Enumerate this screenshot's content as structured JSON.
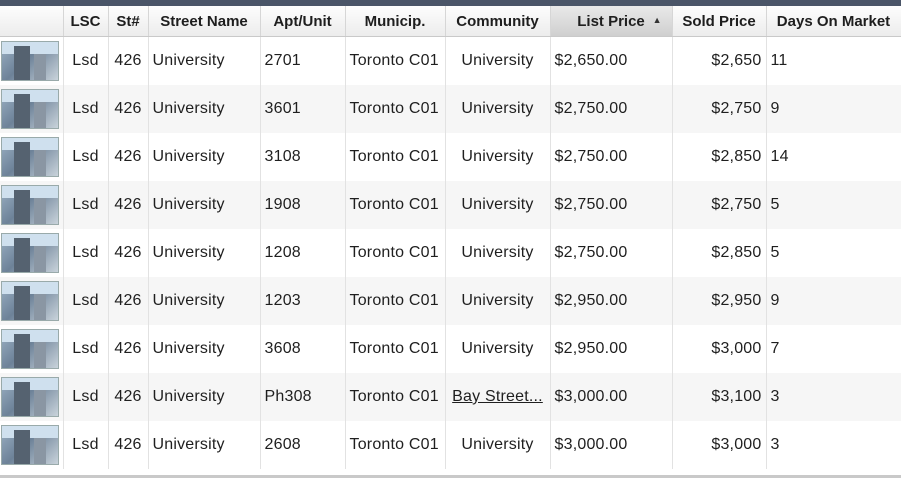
{
  "columns": {
    "lsc": "LSC",
    "st_num": "St#",
    "street_name": "Street Name",
    "apt_unit": "Apt/Unit",
    "municip": "Municip.",
    "community": "Community",
    "list_price": "List Price",
    "sold_price": "Sold Price",
    "days_on_market": "Days On Market"
  },
  "sort": {
    "column": "list_price",
    "direction": "ascending",
    "icon": "sort-up-arrow-icon"
  },
  "rows": [
    {
      "lsc": "Lsd",
      "st_num": "426",
      "street_name": "University",
      "apt_unit": "2701",
      "municip": "Toronto C01",
      "community": "University",
      "list_price": "$2,650.00",
      "sold_price": "$2,650",
      "dom": "11"
    },
    {
      "lsc": "Lsd",
      "st_num": "426",
      "street_name": "University",
      "apt_unit": "3601",
      "municip": "Toronto C01",
      "community": "University",
      "list_price": "$2,750.00",
      "sold_price": "$2,750",
      "dom": "9"
    },
    {
      "lsc": "Lsd",
      "st_num": "426",
      "street_name": "University",
      "apt_unit": "3108",
      "municip": "Toronto C01",
      "community": "University",
      "list_price": "$2,750.00",
      "sold_price": "$2,850",
      "dom": "14"
    },
    {
      "lsc": "Lsd",
      "st_num": "426",
      "street_name": "University",
      "apt_unit": "1908",
      "municip": "Toronto C01",
      "community": "University",
      "list_price": "$2,750.00",
      "sold_price": "$2,750",
      "dom": "5"
    },
    {
      "lsc": "Lsd",
      "st_num": "426",
      "street_name": "University",
      "apt_unit": "1208",
      "municip": "Toronto C01",
      "community": "University",
      "list_price": "$2,750.00",
      "sold_price": "$2,850",
      "dom": "5"
    },
    {
      "lsc": "Lsd",
      "st_num": "426",
      "street_name": "University",
      "apt_unit": "1203",
      "municip": "Toronto C01",
      "community": "University",
      "list_price": "$2,950.00",
      "sold_price": "$2,950",
      "dom": "9"
    },
    {
      "lsc": "Lsd",
      "st_num": "426",
      "street_name": "University",
      "apt_unit": "3608",
      "municip": "Toronto C01",
      "community": "University",
      "list_price": "$2,950.00",
      "sold_price": "$3,000",
      "dom": "7"
    },
    {
      "lsc": "Lsd",
      "st_num": "426",
      "street_name": "University",
      "apt_unit": "Ph308",
      "municip": "Toronto C01",
      "community": "Bay Street...",
      "list_price": "$3,000.00",
      "sold_price": "$3,100",
      "dom": "3"
    },
    {
      "lsc": "Lsd",
      "st_num": "426",
      "street_name": "University",
      "apt_unit": "2608",
      "municip": "Toronto C01",
      "community": "University",
      "list_price": "$3,000.00",
      "sold_price": "$3,000",
      "dom": "3"
    }
  ]
}
